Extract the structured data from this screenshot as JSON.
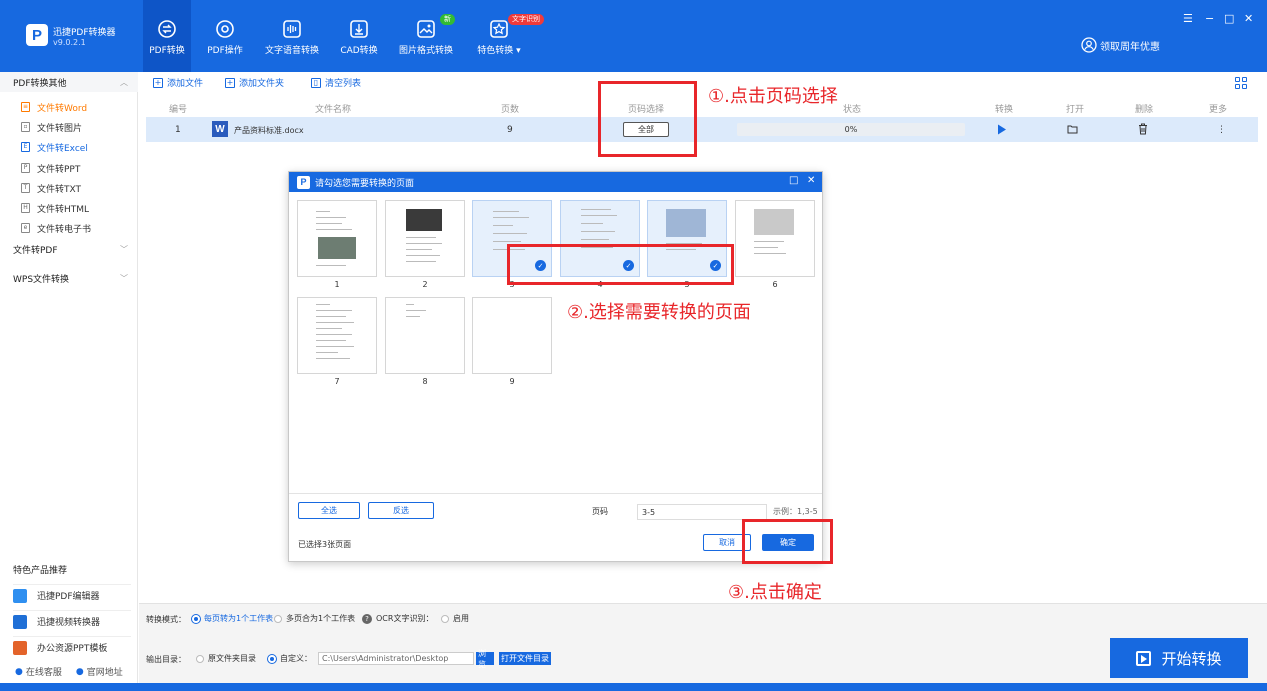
{
  "app": {
    "name": "迅捷PDF转换器",
    "version": "v9.0.2.1",
    "logo_letter": "P"
  },
  "nav": {
    "tabs": [
      {
        "label": "PDF转换",
        "icon": "convert-icon"
      },
      {
        "label": "PDF操作",
        "icon": "settings-icon"
      },
      {
        "label": "文字语音转换",
        "icon": "audio-icon"
      },
      {
        "label": "CAD转换",
        "icon": "cad-icon"
      },
      {
        "label": "图片格式转换",
        "icon": "image-icon"
      },
      {
        "label": "特色转换 ▾",
        "icon": "star-icon"
      }
    ],
    "badge_new": "新",
    "badge_ocr": "文字识别",
    "promo": "领取周年优惠"
  },
  "window_controls": {
    "menu": "☰",
    "minimize": "−",
    "maximize": "□",
    "close": "✕"
  },
  "sidebar": {
    "group1": "PDF转换其他",
    "items": [
      "文件转Word",
      "文件转图片",
      "文件转Excel",
      "文件转PPT",
      "文件转TXT",
      "文件转HTML",
      "文件转电子书"
    ],
    "group2": "文件转PDF",
    "group3": "WPS文件转换",
    "featured_title": "特色产品推荐",
    "featured": [
      "迅捷PDF编辑器",
      "迅捷视频转换器",
      "办公资源PPT模板"
    ],
    "footer": [
      "在线客服",
      "官网地址"
    ]
  },
  "toolbar": {
    "add_file": "添加文件",
    "add_folder": "添加文件夹",
    "clear_list": "清空列表"
  },
  "table": {
    "headers": [
      "编号",
      "文件名称",
      "页数",
      "页码选择",
      "状态",
      "转换",
      "打开",
      "删除",
      "更多"
    ],
    "row": {
      "index": "1",
      "file_icon": "W",
      "filename": "产品资料标准.docx",
      "pages": "9",
      "page_select": "全部",
      "progress": 0,
      "progress_text": "0%",
      "more": "⋮"
    }
  },
  "annotations": {
    "step1": "①.点击页码选择",
    "step2": "②.选择需要转换的页面",
    "step3": "③.点击确定"
  },
  "dialog": {
    "title": "请勾选您需要转换的页面",
    "pages": [
      {
        "num": "1",
        "selected": false
      },
      {
        "num": "2",
        "selected": false
      },
      {
        "num": "3",
        "selected": true
      },
      {
        "num": "4",
        "selected": true
      },
      {
        "num": "5",
        "selected": true
      },
      {
        "num": "6",
        "selected": false
      },
      {
        "num": "7",
        "selected": false
      },
      {
        "num": "8",
        "selected": false
      },
      {
        "num": "9",
        "selected": false
      }
    ],
    "select_all": "全选",
    "invert": "反选",
    "page_label": "页码",
    "page_value": "3-5",
    "example": "示例：1,3-5",
    "status": "已选择3张页面",
    "cancel": "取消",
    "confirm": "确定"
  },
  "bottom": {
    "mode_label": "转换模式：",
    "mode1": "每页转为1个工作表",
    "mode2": "多页合为1个工作表",
    "ocr_label": "OCR文字识别：",
    "ocr_enable": "启用",
    "output_label": "输出目录：",
    "opt_source": "原文件夹目录",
    "opt_custom": "自定义：",
    "path": "C:\\Users\\Administrator\\Desktop",
    "browse": "浏览",
    "open_dir": "打开文件目录",
    "start": "开始转换"
  },
  "colors": {
    "primary": "#1769e0",
    "accent_orange": "#ff7a00",
    "annotation_red": "#e8262a"
  }
}
